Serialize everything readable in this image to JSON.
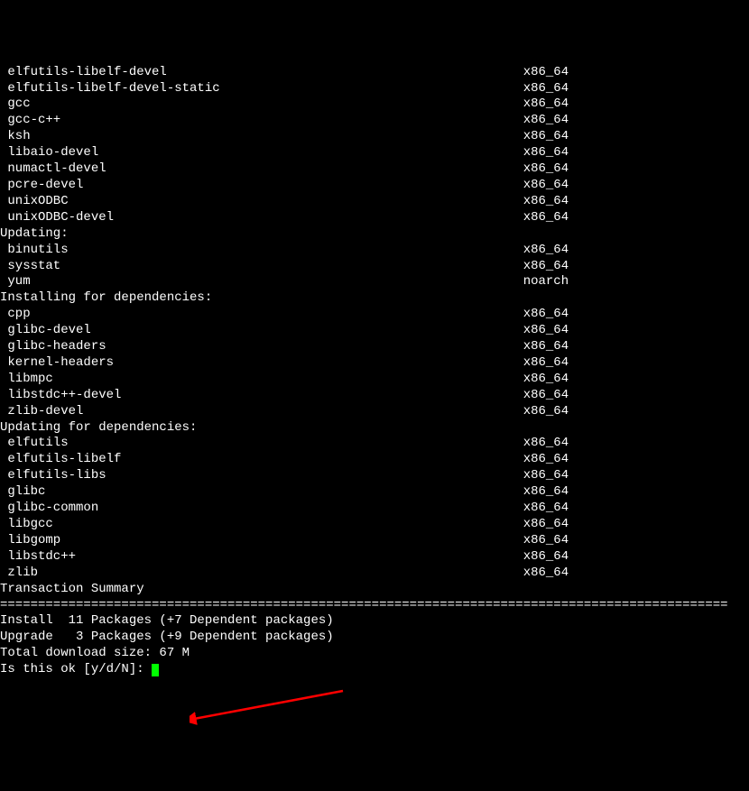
{
  "packages_top": [
    {
      "name": "elfutils-libelf-devel",
      "arch": "x86_64"
    },
    {
      "name": "elfutils-libelf-devel-static",
      "arch": "x86_64"
    },
    {
      "name": "gcc",
      "arch": "x86_64"
    },
    {
      "name": "gcc-c++",
      "arch": "x86_64"
    },
    {
      "name": "ksh",
      "arch": "x86_64"
    },
    {
      "name": "libaio-devel",
      "arch": "x86_64"
    },
    {
      "name": "numactl-devel",
      "arch": "x86_64"
    },
    {
      "name": "pcre-devel",
      "arch": "x86_64"
    },
    {
      "name": "unixODBC",
      "arch": "x86_64"
    },
    {
      "name": "unixODBC-devel",
      "arch": "x86_64"
    }
  ],
  "updating_label": "Updating:",
  "updating": [
    {
      "name": "binutils",
      "arch": "x86_64"
    },
    {
      "name": "sysstat",
      "arch": "x86_64"
    },
    {
      "name": "yum",
      "arch": "noarch"
    }
  ],
  "installing_deps_label": "Installing for dependencies:",
  "installing_deps": [
    {
      "name": "cpp",
      "arch": "x86_64"
    },
    {
      "name": "glibc-devel",
      "arch": "x86_64"
    },
    {
      "name": "glibc-headers",
      "arch": "x86_64"
    },
    {
      "name": "kernel-headers",
      "arch": "x86_64"
    },
    {
      "name": "libmpc",
      "arch": "x86_64"
    },
    {
      "name": "libstdc++-devel",
      "arch": "x86_64"
    },
    {
      "name": "zlib-devel",
      "arch": "x86_64"
    }
  ],
  "updating_deps_label": "Updating for dependencies:",
  "updating_deps": [
    {
      "name": "elfutils",
      "arch": "x86_64"
    },
    {
      "name": "elfutils-libelf",
      "arch": "x86_64"
    },
    {
      "name": "elfutils-libs",
      "arch": "x86_64"
    },
    {
      "name": "glibc",
      "arch": "x86_64"
    },
    {
      "name": "glibc-common",
      "arch": "x86_64"
    },
    {
      "name": "libgcc",
      "arch": "x86_64"
    },
    {
      "name": "libgomp",
      "arch": "x86_64"
    },
    {
      "name": "libstdc++",
      "arch": "x86_64"
    },
    {
      "name": "zlib",
      "arch": "x86_64"
    }
  ],
  "summary_heading": "Transaction Summary",
  "divider": "================================================================================================",
  "install_line": "Install  11 Packages (+7 Dependent packages)",
  "upgrade_line": "Upgrade   3 Packages (+9 Dependent packages)",
  "download_size": "Total download size: 67 M",
  "prompt": "Is this ok [y/d/N]: "
}
